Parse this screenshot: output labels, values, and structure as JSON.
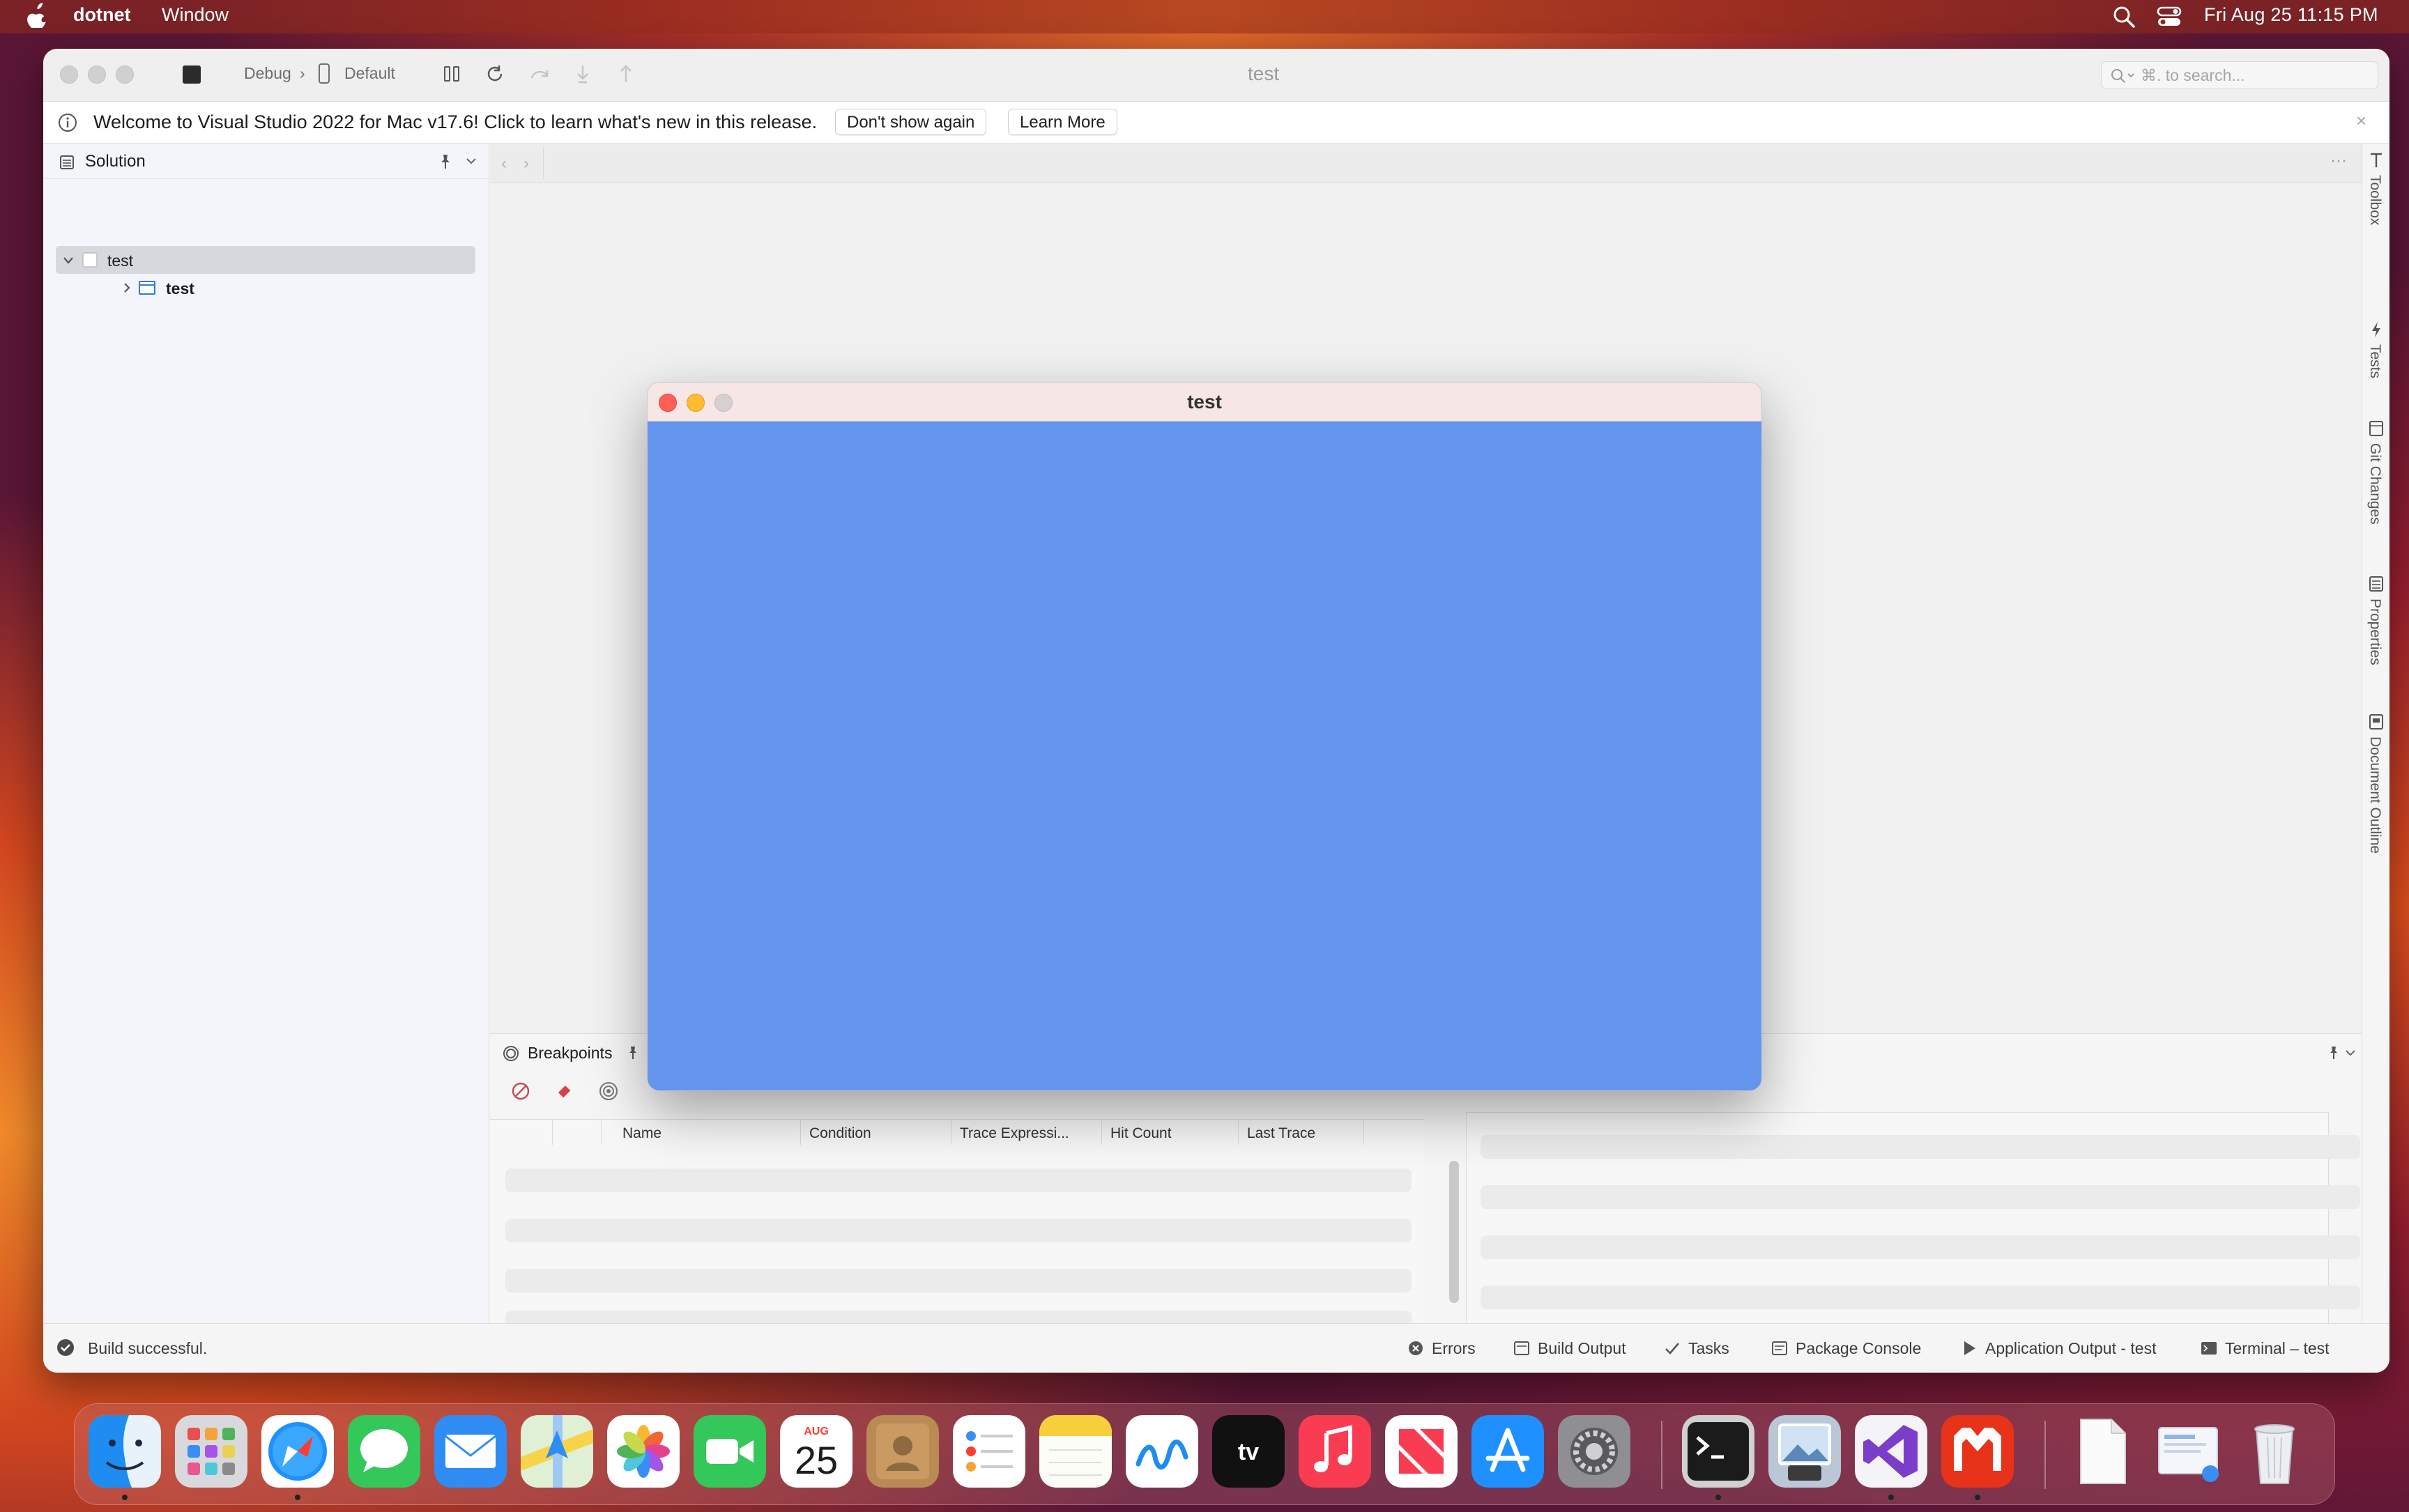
{
  "menubar": {
    "app_name": "dotnet",
    "menu_window": "Window",
    "clock": "Fri Aug 25  11:15 PM"
  },
  "toolbar": {
    "configuration": "Debug",
    "device": "Default",
    "title": "test",
    "search_placeholder": "⌘. to search..."
  },
  "infobar": {
    "message": "Welcome to Visual Studio 2022 for Mac v17.6! Click to learn what's new in this release.",
    "dont_show": "Don't show again",
    "learn_more": "Learn More",
    "close": "×"
  },
  "sidebar": {
    "title": "Solution",
    "tree": [
      {
        "label": "test",
        "level": 0,
        "expanded": true,
        "selected": true
      },
      {
        "label": "test",
        "level": 1,
        "expanded": false,
        "selected": false
      }
    ]
  },
  "editor": {
    "back": "‹",
    "forward": "›",
    "more": "···"
  },
  "right_rail": [
    "Toolbox",
    "Tests",
    "Git Changes",
    "Properties",
    "Document Outline"
  ],
  "breakpoints": {
    "title": "Breakpoints",
    "columns": [
      "",
      "",
      "Name",
      "Condition",
      "Trace Expressi...",
      "Hit Count",
      "Last Trace"
    ]
  },
  "statusbar": {
    "message": "Build successful.",
    "tabs": [
      "Errors",
      "Build Output",
      "Tasks",
      "Package Console",
      "Application Output - test",
      "Terminal – test"
    ]
  },
  "app_window": {
    "title": "test",
    "background": "#6495ed"
  },
  "dock": {
    "apps": [
      "Finder",
      "Launchpad",
      "Safari",
      "Messages",
      "Mail",
      "Maps",
      "Photos",
      "FaceTime",
      "Calendar",
      "Contacts",
      "Reminders",
      "Notes",
      "Freeform",
      "TV",
      "Music",
      "News",
      "App Store",
      "System Settings",
      "Terminal",
      "Preview",
      "Visual Studio",
      "MonoGame",
      "Document",
      "Downloads",
      "Trash"
    ],
    "calendar_month": "AUG",
    "calendar_day": "25"
  },
  "colors": {
    "accent": "#0a84ff",
    "app_canvas": "#6495ed",
    "close_red": "#ff5f57",
    "minimize_yellow": "#febc2e"
  }
}
